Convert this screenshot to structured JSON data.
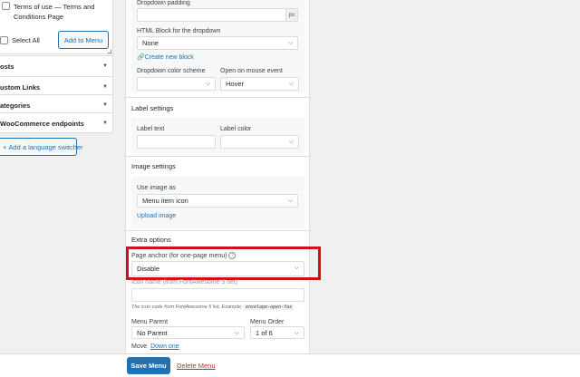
{
  "left_panel": {
    "terms_item": "Terms of use — Terms and Conditions Page",
    "select_all": "Select All",
    "add_to_menu": "Add to Menu",
    "accordions": [
      "osts",
      "ustom Links",
      "ategories",
      "WooCommerce endpoints"
    ],
    "language_switcher": "Add a language switcher"
  },
  "settings": {
    "dropdown_padding_label": "Dropdown padding",
    "px_suffix": "px",
    "html_block_label": "HTML Block for the dropdown",
    "html_block_value": "None",
    "create_new_block": "Create new block",
    "dropdown_color_label": "Dropdown color scheme",
    "dropdown_color_value": "",
    "open_on_mouse_label": "Open on mouse event",
    "open_on_mouse_value": "Hover",
    "label_settings_title": "Label settings",
    "label_text_label": "Label text",
    "label_text_value": "",
    "label_color_label": "Label color",
    "label_color_value": "",
    "image_settings_title": "Image settings",
    "use_image_label": "Use image as",
    "use_image_value": "Menu item icon",
    "upload_image": "Upload image",
    "extra_options_title": "Extra options",
    "page_anchor_label": "Page anchor (for one-page menu)",
    "page_anchor_value": "Disable",
    "icon_name_label": "Icon name (from FontAwesome 5 set)",
    "icon_name_value": "",
    "icon_hint": "The icon code from FontAwesome 5 list. Example:",
    "icon_hint_code": "envelope-open-fas",
    "menu_parent_label": "Menu Parent",
    "menu_parent_value": "No Parent",
    "menu_order_label": "Menu Order",
    "menu_order_value": "1 of 6",
    "move_label": "Move",
    "move_down": "Down one"
  },
  "footer": {
    "save_menu": "Save Menu",
    "delete_menu": "Delete Menu"
  },
  "colors": {
    "accent": "#2271b1",
    "highlight": "#d30f1c",
    "delete": "#b32d2e"
  }
}
